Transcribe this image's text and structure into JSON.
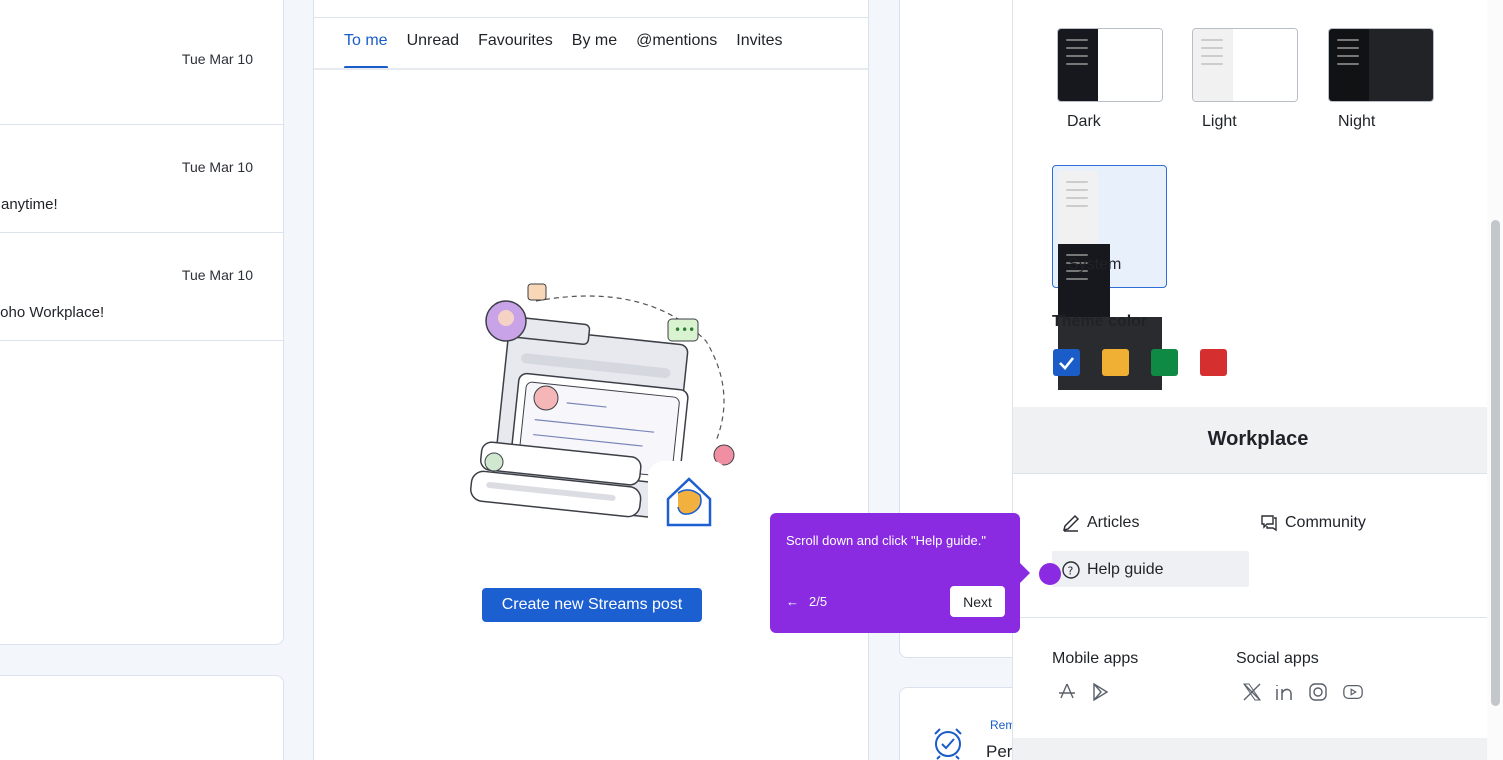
{
  "mail_list": {
    "rows": [
      {
        "date": "Tue Mar 10",
        "snippet": ""
      },
      {
        "date": "Tue Mar 10",
        "snippet": "anytime!"
      },
      {
        "date": "Tue Mar 10",
        "snippet": "Zoho Workplace!"
      }
    ]
  },
  "streams": {
    "tabs": [
      "To me",
      "Unread",
      "Favourites",
      "By me",
      "@mentions",
      "Invites"
    ],
    "active_tab": "To me",
    "create_button": "Create new Streams post"
  },
  "reminder": {
    "label": "Rem",
    "title": "Per"
  },
  "appearance": {
    "themes": [
      "Dark",
      "Light",
      "Night",
      "System"
    ],
    "selected_theme": "System",
    "theme_color_label": "Theme color",
    "colors": [
      "#1a5cc8",
      "#f0b034",
      "#0f8a45",
      "#d52f2f"
    ],
    "selected_color": "#1a5cc8"
  },
  "workplace": {
    "title": "Workplace",
    "links": {
      "articles": "Articles",
      "community": "Community",
      "help_guide": "Help guide"
    },
    "mobile_apps": "Mobile apps",
    "social_apps": "Social apps",
    "mobile_icons": [
      "app-store-icon",
      "play-store-icon"
    ],
    "social_icons": [
      "x-icon",
      "linkedin-icon",
      "instagram-icon",
      "youtube-icon"
    ]
  },
  "tooltip": {
    "message": "Scroll down and click \"Help guide.\"",
    "back_arrow": "←",
    "step": "2/5",
    "next_label": "Next"
  }
}
